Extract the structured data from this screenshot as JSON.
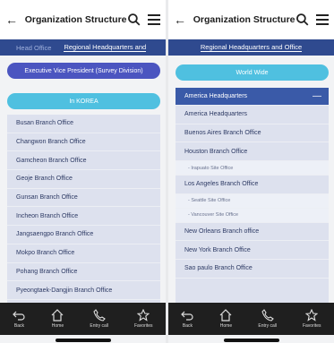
{
  "left": {
    "title": "Organization Structure",
    "tabs": [
      "Head Office",
      "Regional Headquarters and"
    ],
    "active_tab": 1,
    "pill_purple": "Executive Vice President (Survey Division)",
    "pill_cyan": "In KOREA",
    "rows": [
      "Busan Branch Office",
      "Changwon Branch Office",
      "Gamcheon Branch Office",
      "Geoje Branch Office",
      "Gunsan Branch Office",
      "Incheon Branch Office",
      "Jangsaengpo Branch Office",
      "Mokpo Branch Office",
      "Pohang Branch Office",
      "Pyeongtaek-Dangjin Branch Office"
    ]
  },
  "right": {
    "title": "Organization Structure",
    "tabs": [
      "Regional Headquarters and Office"
    ],
    "pill_cyan": "World Wide",
    "group_head": "America Headquarters",
    "group_minus": "—",
    "items": [
      {
        "label": "America Headquarters",
        "sub": false
      },
      {
        "label": "Buenos Aires Branch Office",
        "sub": false
      },
      {
        "label": "Houston Branch Office",
        "sub": false
      },
      {
        "label": "- Irapuato Site Office",
        "sub": true
      },
      {
        "label": "Los Angeles Branch Office",
        "sub": false
      },
      {
        "label": "- Seattle Site Office",
        "sub": true
      },
      {
        "label": "- Vancouver Site Office",
        "sub": true
      },
      {
        "label": "New Orleans Branch office",
        "sub": false
      },
      {
        "label": "New York Branch Office",
        "sub": false
      },
      {
        "label": "Sao paulo Branch Office",
        "sub": false
      }
    ]
  },
  "bottom_nav": [
    {
      "label": "Back",
      "icon": "back-icon"
    },
    {
      "label": "Home",
      "icon": "home-icon"
    },
    {
      "label": "Entry call",
      "icon": "phone-icon"
    },
    {
      "label": "Favorites",
      "icon": "star-icon"
    }
  ]
}
